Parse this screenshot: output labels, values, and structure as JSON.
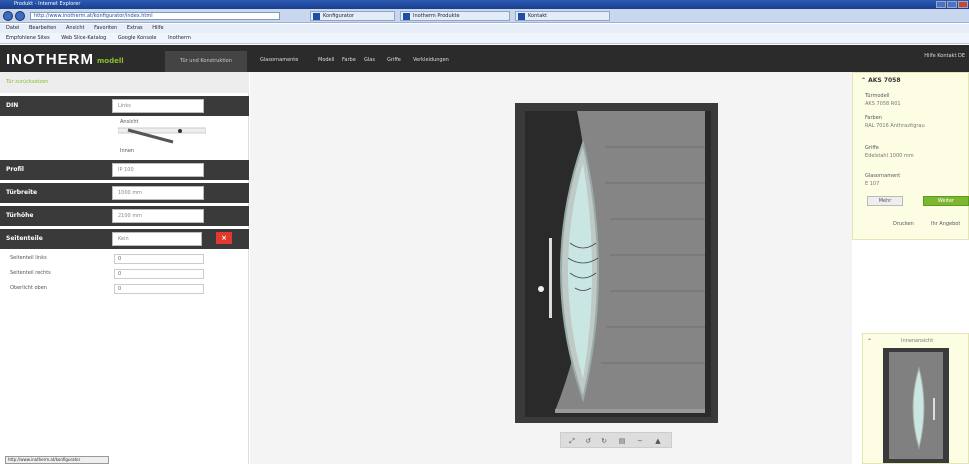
{
  "browser": {
    "title": "Produkt - Internet Explorer",
    "address": "http://www.inotherm.at/konfigurator/index.html",
    "tabs": [
      "Konfigurator",
      "Inotherm Produkte",
      "Kontakt"
    ],
    "menu": [
      "Datei",
      "Bearbeiten",
      "Ansicht",
      "Favoriten",
      "Extras",
      "Hilfe"
    ],
    "favorites": [
      "Empfohlene Sites",
      "Web Slice-Katalog",
      "Google Konsole",
      "Inotherm"
    ]
  },
  "app": {
    "logo": "INOTHERM",
    "logo_sub": "modell",
    "first_tab": "Tür und Konstruktion",
    "nav": [
      "Glasornamente",
      "Modell",
      "Farbe",
      "Glas",
      "Griffe",
      "Verkleidungen"
    ],
    "header_right": "Hilfe  Kontakt  DE"
  },
  "left": {
    "subbar": "Tür zurücksetzen",
    "rows": [
      {
        "label": "DIN",
        "value": "Links"
      },
      {
        "label": "Profil",
        "value": "IP 100"
      },
      {
        "label": "Türbreite",
        "value": "1000 mm"
      },
      {
        "label": "Türhöhe",
        "value": "2100 mm"
      },
      {
        "label": "Seitenteile",
        "value": "Kein"
      }
    ],
    "din_hint_top": "Ansicht",
    "din_hint_bottom": "Innen",
    "subfields": [
      {
        "label": "Seitenteil links",
        "value": "0"
      },
      {
        "label": "Seitenteil rechts",
        "value": "0"
      },
      {
        "label": "Oberlicht oben",
        "value": "0"
      }
    ],
    "status": "http://www.inotherm.at/konfigurator"
  },
  "info": {
    "title": "AKS 7058",
    "sections": [
      {
        "label": "Türmodell",
        "value": "AKS 7058 R01"
      },
      {
        "label": "Farben",
        "value": "RAL 7016 Anthrazitgrau"
      },
      {
        "label": "Griffe",
        "value": "Edelstahl 1000 mm"
      },
      {
        "label": "Glasornament",
        "value": "E 107"
      }
    ],
    "more": "Mehr",
    "next": "Weiter",
    "link1": "Drucken",
    "link2": "Ihr Angebot"
  },
  "preview": {
    "title": "Innenansicht"
  },
  "colors": {
    "door": "#3d3d3d",
    "accent": "#7db732",
    "delete": "#e03a2f"
  }
}
